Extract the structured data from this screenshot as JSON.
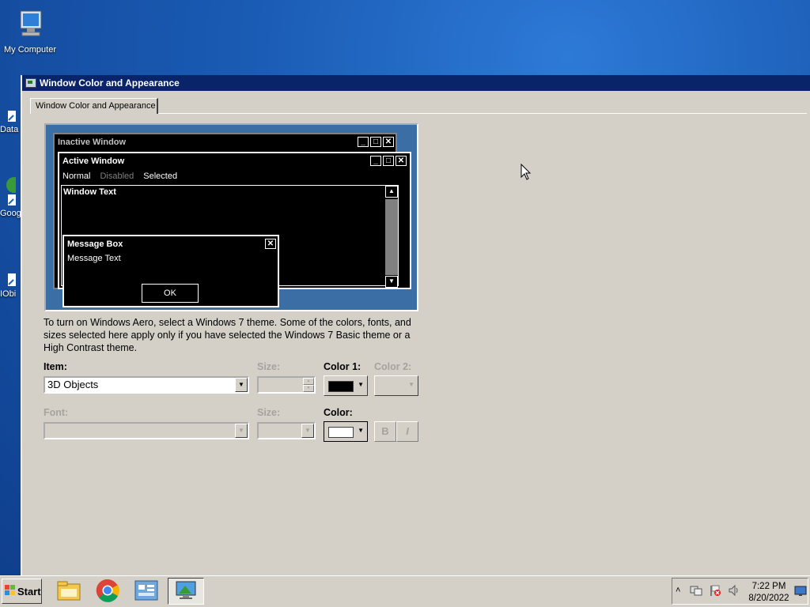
{
  "desktop": {
    "icons": [
      {
        "label": "My Computer"
      },
      {
        "label": "Data"
      },
      {
        "label": "Goog"
      },
      {
        "label": "IObi"
      }
    ]
  },
  "window": {
    "title": "Window Color and Appearance",
    "tab_label": "Window Color and Appearance"
  },
  "preview": {
    "inactive_title": "Inactive Window",
    "active_title": "Active Window",
    "menu_normal": "Normal",
    "menu_disabled": "Disabled",
    "menu_selected": "Selected",
    "window_text": "Window Text",
    "msgbox_title": "Message Box",
    "msgbox_text": "Message Text",
    "ok_label": "OK"
  },
  "description": "To turn on Windows Aero, select a Windows 7 theme.  Some of the colors, fonts, and sizes selected here apply only if you have selected the Windows 7 Basic theme or a High Contrast theme.",
  "form": {
    "item_label": "Item:",
    "item_value": "3D Objects",
    "size_label": "Size:",
    "color1_label": "Color 1:",
    "color2_label": "Color 2:",
    "font_label": "Font:",
    "font_size_label": "Size:",
    "font_color_label": "Color:",
    "bold_label": "B",
    "italic_label": "I",
    "color1_value": "#000000",
    "font_color_value": "#ffffff"
  },
  "taskbar": {
    "start_label": "Start",
    "apps": [
      "file-explorer",
      "chrome",
      "control-panel",
      "display-settings"
    ],
    "time": "7:22 PM",
    "date": "8/20/2022"
  }
}
